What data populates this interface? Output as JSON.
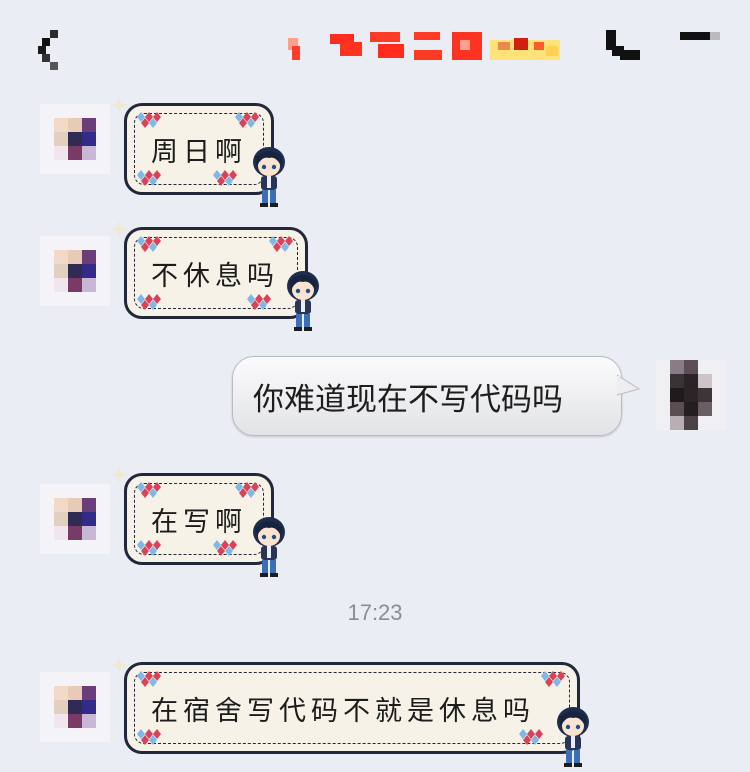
{
  "header": {
    "back_icon": "back-chevron-icon",
    "title_colors": [
      "#ff4a2a",
      "#ff6b3d",
      "#ffd166",
      "#e84a2f"
    ],
    "call_icon": "phone-icon",
    "menu_icon": "menu-icon"
  },
  "messages": [
    {
      "from": "other",
      "text": "周日啊"
    },
    {
      "from": "other",
      "text": "不休息吗"
    },
    {
      "from": "me",
      "text": "你难道现在不写代码吗"
    },
    {
      "from": "other",
      "text": "在写啊"
    },
    {
      "from": "other",
      "text": "在宿舍写代码不就是休息吗"
    }
  ],
  "timestamp": "17:23",
  "colors": {
    "background": "#ebedf5",
    "sticker_border": "#22283a",
    "sticker_fill": "#f6f2e8",
    "diamond_red": "#d9435a",
    "diamond_blue": "#7fb7e6"
  }
}
